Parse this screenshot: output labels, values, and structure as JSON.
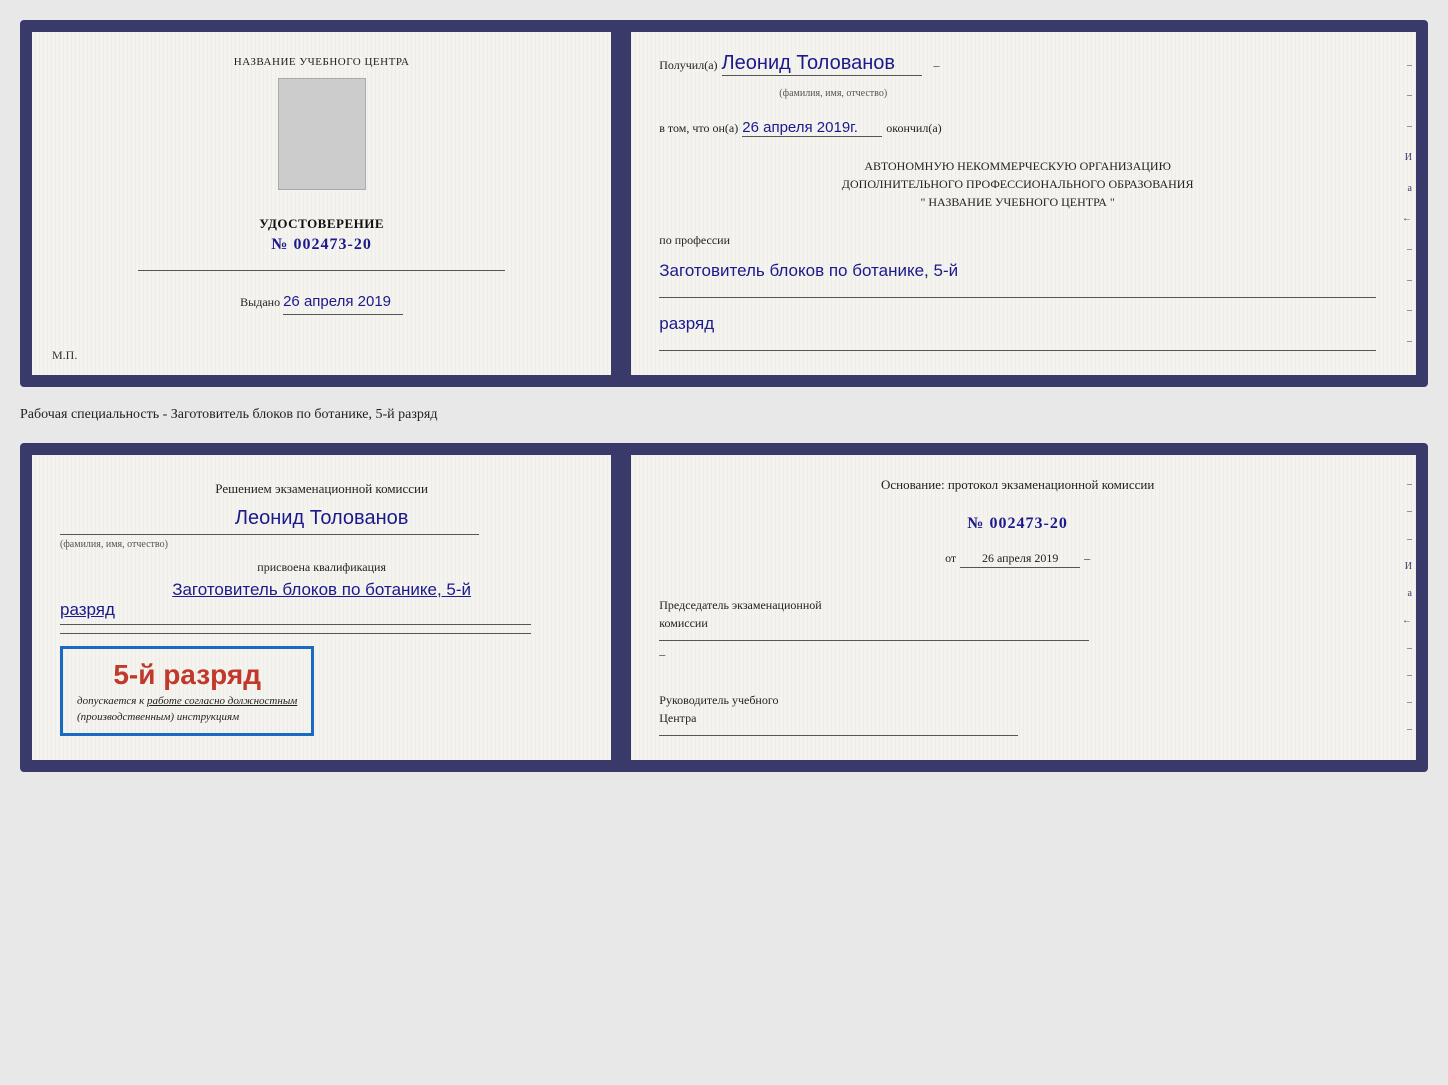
{
  "doc1": {
    "left": {
      "training_center_label": "НАЗВАНИЕ УЧЕБНОГО ЦЕНТРА",
      "cert_type": "УДОСТОВЕРЕНИЕ",
      "cert_number_prefix": "№",
      "cert_number": "002473-20",
      "issued_label": "Выдано",
      "issued_date": "26 апреля 2019",
      "mp_label": "М.П."
    },
    "right": {
      "received_label": "Получил(а)",
      "full_name": "Леонид Толованов",
      "full_name_sub": "(фамилия, имя, отчество)",
      "certifies_label": "в том, что он(а)",
      "date_value": "26 апреля 2019г.",
      "finished_label": "окончил(а)",
      "org_line1": "АВТОНОМНУЮ НЕКОММЕРЧЕСКУЮ ОРГАНИЗАЦИЮ",
      "org_line2": "ДОПОЛНИТЕЛЬНОГО ПРОФЕССИОНАЛЬНОГО ОБРАЗОВАНИЯ",
      "org_line3": "\"    НАЗВАНИЕ УЧЕБНОГО ЦЕНТРА    \"",
      "profession_label": "по профессии",
      "profession_value": "Заготовитель блоков по ботанике, 5-й",
      "rank_value": "разряд"
    }
  },
  "between_label": "Рабочая специальность - Заготовитель блоков по ботанике, 5-й разряд",
  "doc2": {
    "left": {
      "decision_label": "Решением экзаменационной комиссии",
      "full_name": "Леонид Толованов",
      "full_name_sub": "(фамилия, имя, отчество)",
      "assigned_label": "присвоена квалификация",
      "qualification_line1": "Заготовитель блоков по ботанике, 5-й",
      "qualification_line2": "разряд",
      "stamp_main": "5-й разряд",
      "stamp_allowed": "допускается к",
      "stamp_allowed_rest": "работе согласно должностным",
      "stamp_italic": "(производственным) инструкциям"
    },
    "right": {
      "basis_label": "Основание: протокол экзаменационной комиссии",
      "number_prefix": "№",
      "number_value": "002473-20",
      "date_from_prefix": "от",
      "date_from_value": "26 апреля 2019",
      "chairman_line1": "Председатель экзаменационной",
      "chairman_line2": "комиссии",
      "head_line1": "Руководитель учебного",
      "head_line2": "Центра"
    }
  },
  "deco_chars": [
    "–",
    "–",
    "–",
    "И",
    "ӓ",
    "←",
    "–",
    "–",
    "–",
    "–"
  ],
  "icons": {}
}
